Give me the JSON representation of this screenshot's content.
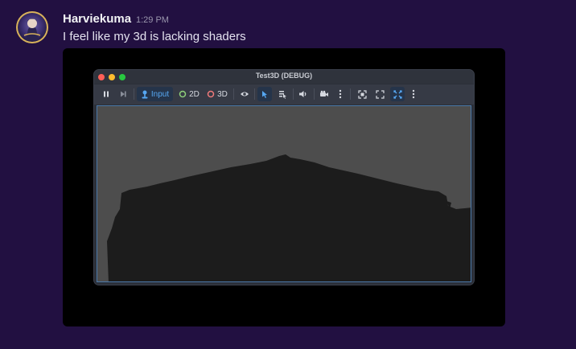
{
  "message": {
    "username": "Harviekuma",
    "timestamp": "1:29 PM",
    "content": "I feel like my 3d is lacking shaders"
  },
  "game_window": {
    "title": "Test3D (DEBUG)",
    "toolbar": {
      "input_label": "Input",
      "mode_2d_label": "2D",
      "mode_3d_label": "3D",
      "active_tool": "Input"
    }
  },
  "colors": {
    "background": "#221041",
    "viewport_sky": "#4d4d4d",
    "terrain": "#1c1c1c",
    "accent": "#56a7f2"
  }
}
